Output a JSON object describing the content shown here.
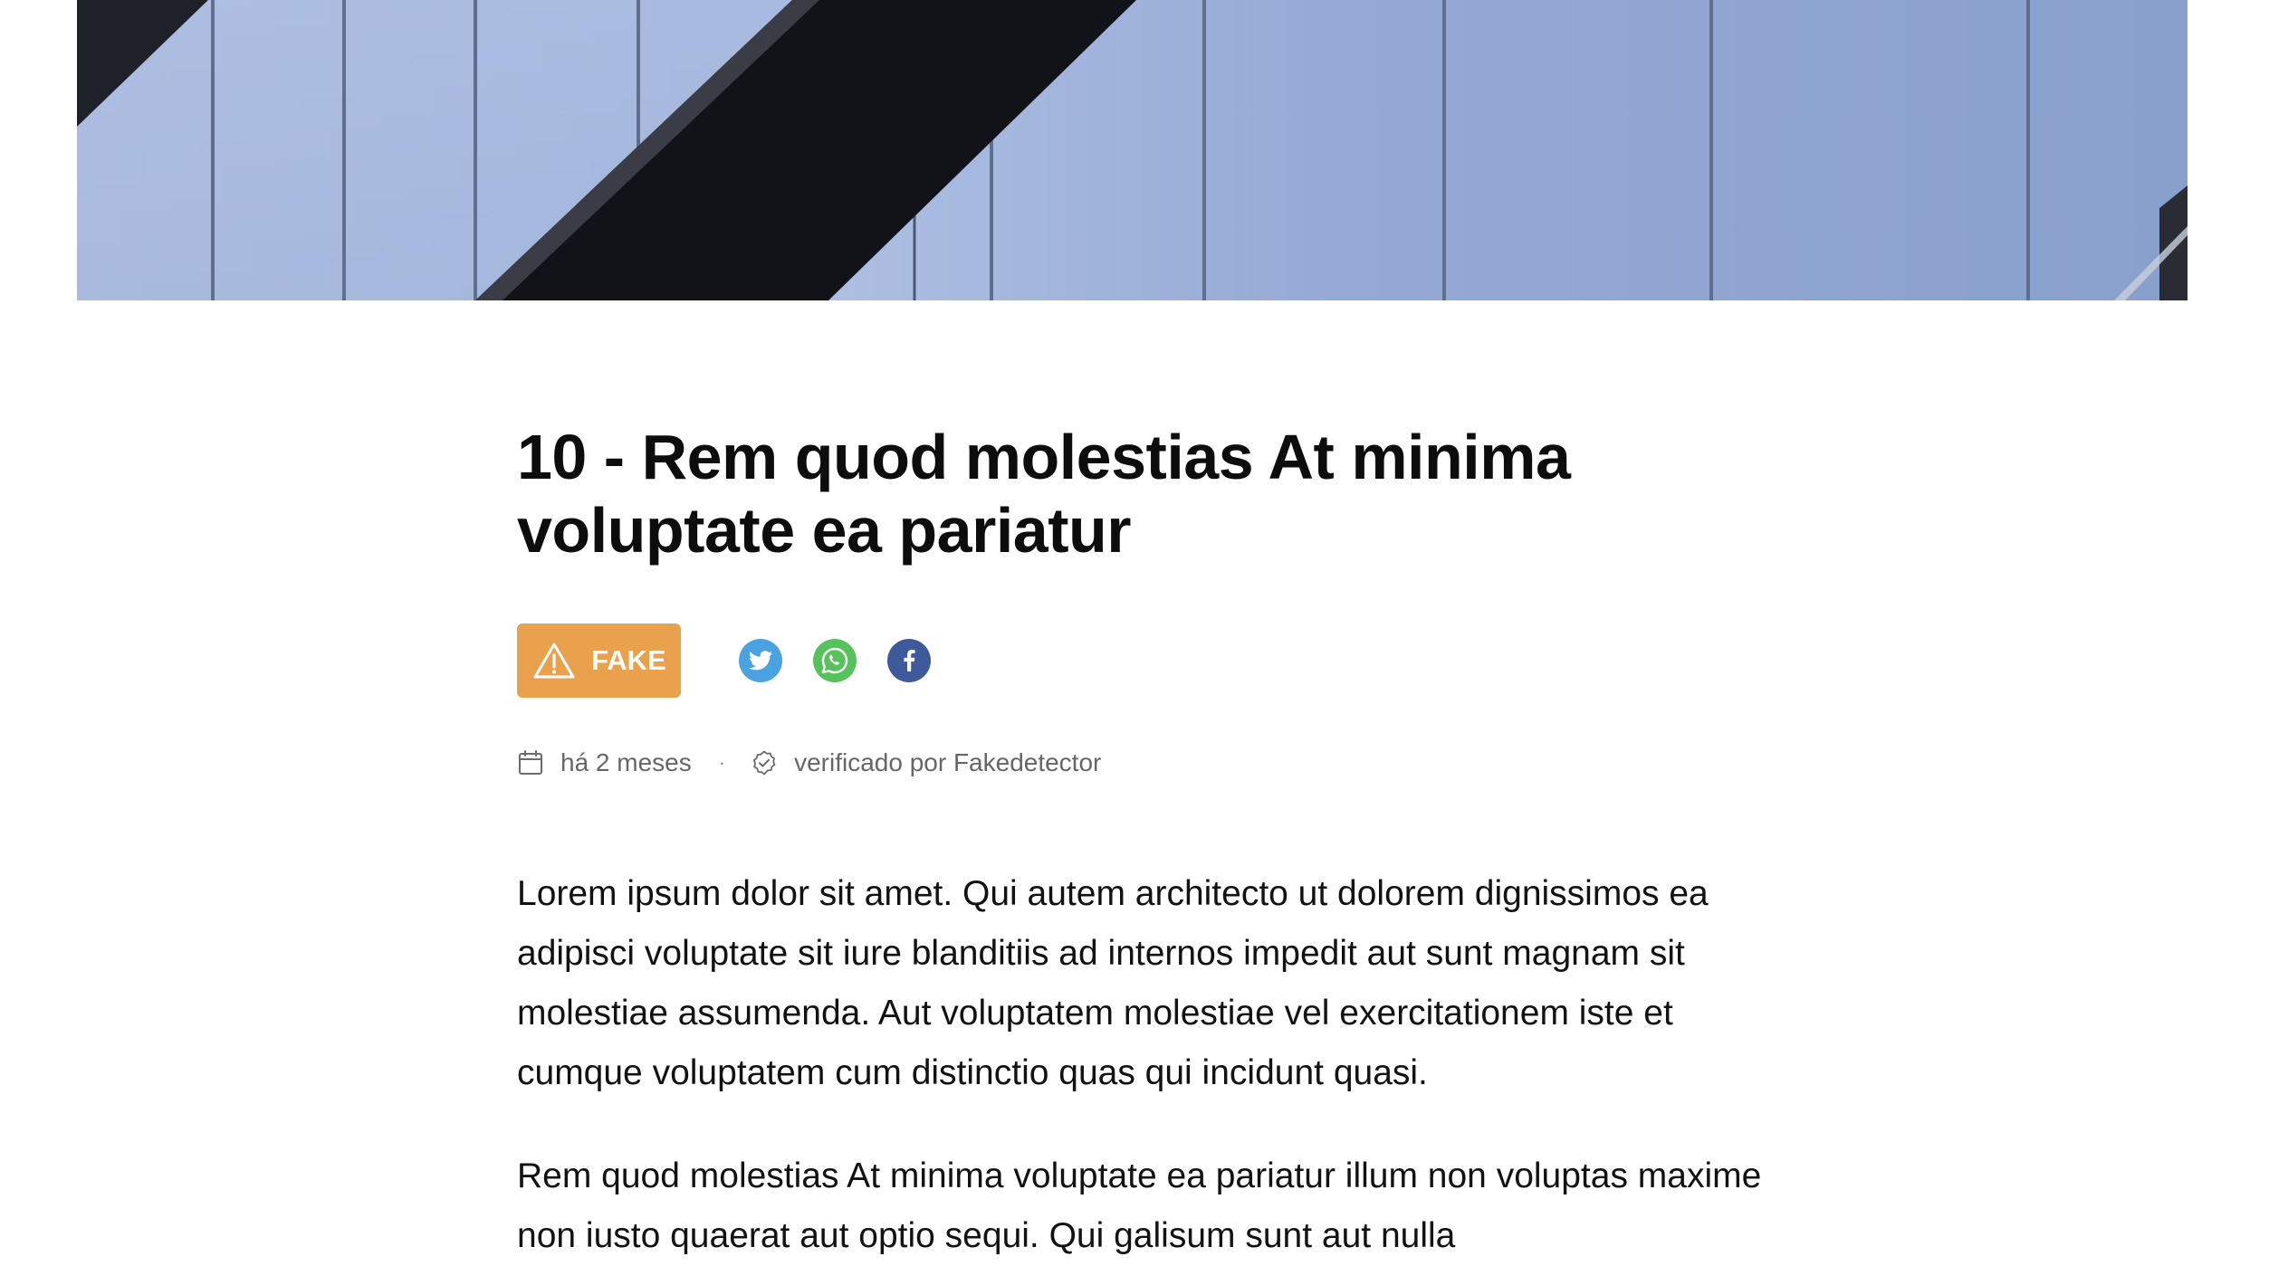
{
  "article": {
    "title": "10 - Rem quod molestias At minima voluptate ea pariatur",
    "verdict": {
      "label": "FAKE",
      "color": "#e9a14d",
      "icon": "warning-triangle-icon"
    },
    "share": [
      {
        "network": "twitter",
        "icon": "twitter-icon",
        "color": "#4aa3e0"
      },
      {
        "network": "whatsapp",
        "icon": "whatsapp-icon",
        "color": "#56c25c"
      },
      {
        "network": "facebook",
        "icon": "facebook-icon",
        "color": "#3f5a9a"
      }
    ],
    "meta": {
      "date": "há 2 meses",
      "date_icon": "calendar-icon",
      "separator": "·",
      "verified": "verificado por Fakedetector",
      "verified_icon": "verified-badge-icon"
    },
    "paragraphs": [
      "Lorem ipsum dolor sit amet. Qui autem architecto ut dolorem dignissimos ea adipisci voluptate sit iure blanditiis ad internos impedit aut sunt magnam sit molestiae assumenda. Aut voluptatem molestiae vel exercitationem iste et cumque voluptatem cum distinctio quas qui incidunt quasi.",
      "Rem quod molestias At minima voluptate ea pariatur illum non voluptas maxime non iusto quaerat aut optio sequi. Qui galisum sunt aut nulla"
    ]
  }
}
